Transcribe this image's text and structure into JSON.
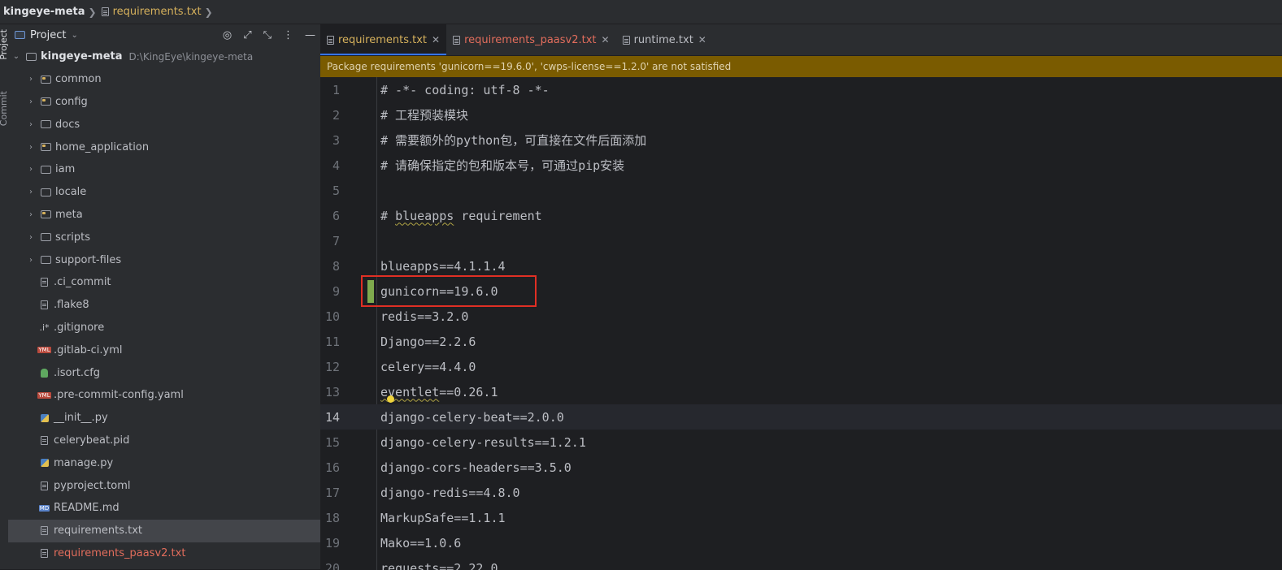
{
  "breadcrumb": {
    "root": "kingeye-meta",
    "file": "requirements.txt"
  },
  "tool_strip": {
    "project_label": "Project",
    "commit_label": "Commit"
  },
  "project_panel": {
    "title": "Project",
    "root": {
      "name": "kingeye-meta",
      "path": "D:\\KingEye\\kingeye-meta"
    },
    "items": [
      {
        "name": "common",
        "kind": "folder"
      },
      {
        "name": "config",
        "kind": "folder"
      },
      {
        "name": "docs",
        "kind": "folder"
      },
      {
        "name": "home_application",
        "kind": "folder"
      },
      {
        "name": "iam",
        "kind": "folder"
      },
      {
        "name": "locale",
        "kind": "folder"
      },
      {
        "name": "meta",
        "kind": "folder"
      },
      {
        "name": "scripts",
        "kind": "folder"
      },
      {
        "name": "support-files",
        "kind": "folder"
      },
      {
        "name": ".ci_commit",
        "kind": "file"
      },
      {
        "name": ".flake8",
        "kind": "file"
      },
      {
        "name": ".gitignore",
        "kind": "gitignore"
      },
      {
        "name": ".gitlab-ci.yml",
        "kind": "yml"
      },
      {
        "name": ".isort.cfg",
        "kind": "cfg"
      },
      {
        "name": ".pre-commit-config.yaml",
        "kind": "yml"
      },
      {
        "name": "__init__.py",
        "kind": "py"
      },
      {
        "name": "celerybeat.pid",
        "kind": "file"
      },
      {
        "name": "manage.py",
        "kind": "py"
      },
      {
        "name": "pyproject.toml",
        "kind": "file"
      },
      {
        "name": "README.md",
        "kind": "md"
      },
      {
        "name": "requirements.txt",
        "kind": "file"
      },
      {
        "name": "requirements_paasv2.txt",
        "kind": "file"
      }
    ]
  },
  "tabs": [
    {
      "label": "requirements.txt",
      "state": "active"
    },
    {
      "label": "requirements_paasv2.txt",
      "state": "modified"
    },
    {
      "label": "runtime.txt",
      "state": "normal"
    }
  ],
  "warning": "Package requirements 'gunicorn==19.6.0', 'cwps-license==1.2.0' are not satisfied",
  "code": [
    {
      "no": "1",
      "text": "# -*- coding: utf-8 -*-"
    },
    {
      "no": "2",
      "text": "# 工程预装模块"
    },
    {
      "no": "3",
      "text": "# 需要额外的python包，可直接在文件后面添加"
    },
    {
      "no": "4",
      "text": "# 请确保指定的包和版本号，可通过pip安装"
    },
    {
      "no": "5",
      "text": ""
    },
    {
      "no": "6",
      "text": "# blueapps requirement"
    },
    {
      "no": "7",
      "text": ""
    },
    {
      "no": "8",
      "text": "blueapps==4.1.1.4"
    },
    {
      "no": "9",
      "text": "gunicorn==19.6.0"
    },
    {
      "no": "10",
      "text": "redis==3.2.0"
    },
    {
      "no": "11",
      "text": "Django==2.2.6"
    },
    {
      "no": "12",
      "text": "celery==4.4.0"
    },
    {
      "no": "13",
      "text": "eventlet==0.26.1"
    },
    {
      "no": "14",
      "text": "django-celery-beat==2.0.0"
    },
    {
      "no": "15",
      "text": "django-celery-results==1.2.1"
    },
    {
      "no": "16",
      "text": "django-cors-headers==3.5.0"
    },
    {
      "no": "17",
      "text": "django-redis==4.8.0"
    },
    {
      "no": "18",
      "text": "MarkupSafe==1.1.1"
    },
    {
      "no": "19",
      "text": "Mako==1.0.6"
    },
    {
      "no": "20",
      "text": "requests==2.22.0"
    }
  ],
  "editor_state": {
    "current_line": "14",
    "highlighted_line": "9"
  },
  "colors": {
    "warning_bg": "#7a5b00",
    "highlight_border": "#e02f24",
    "change_marker": "#7faa4d",
    "accent": "#3574f0"
  }
}
